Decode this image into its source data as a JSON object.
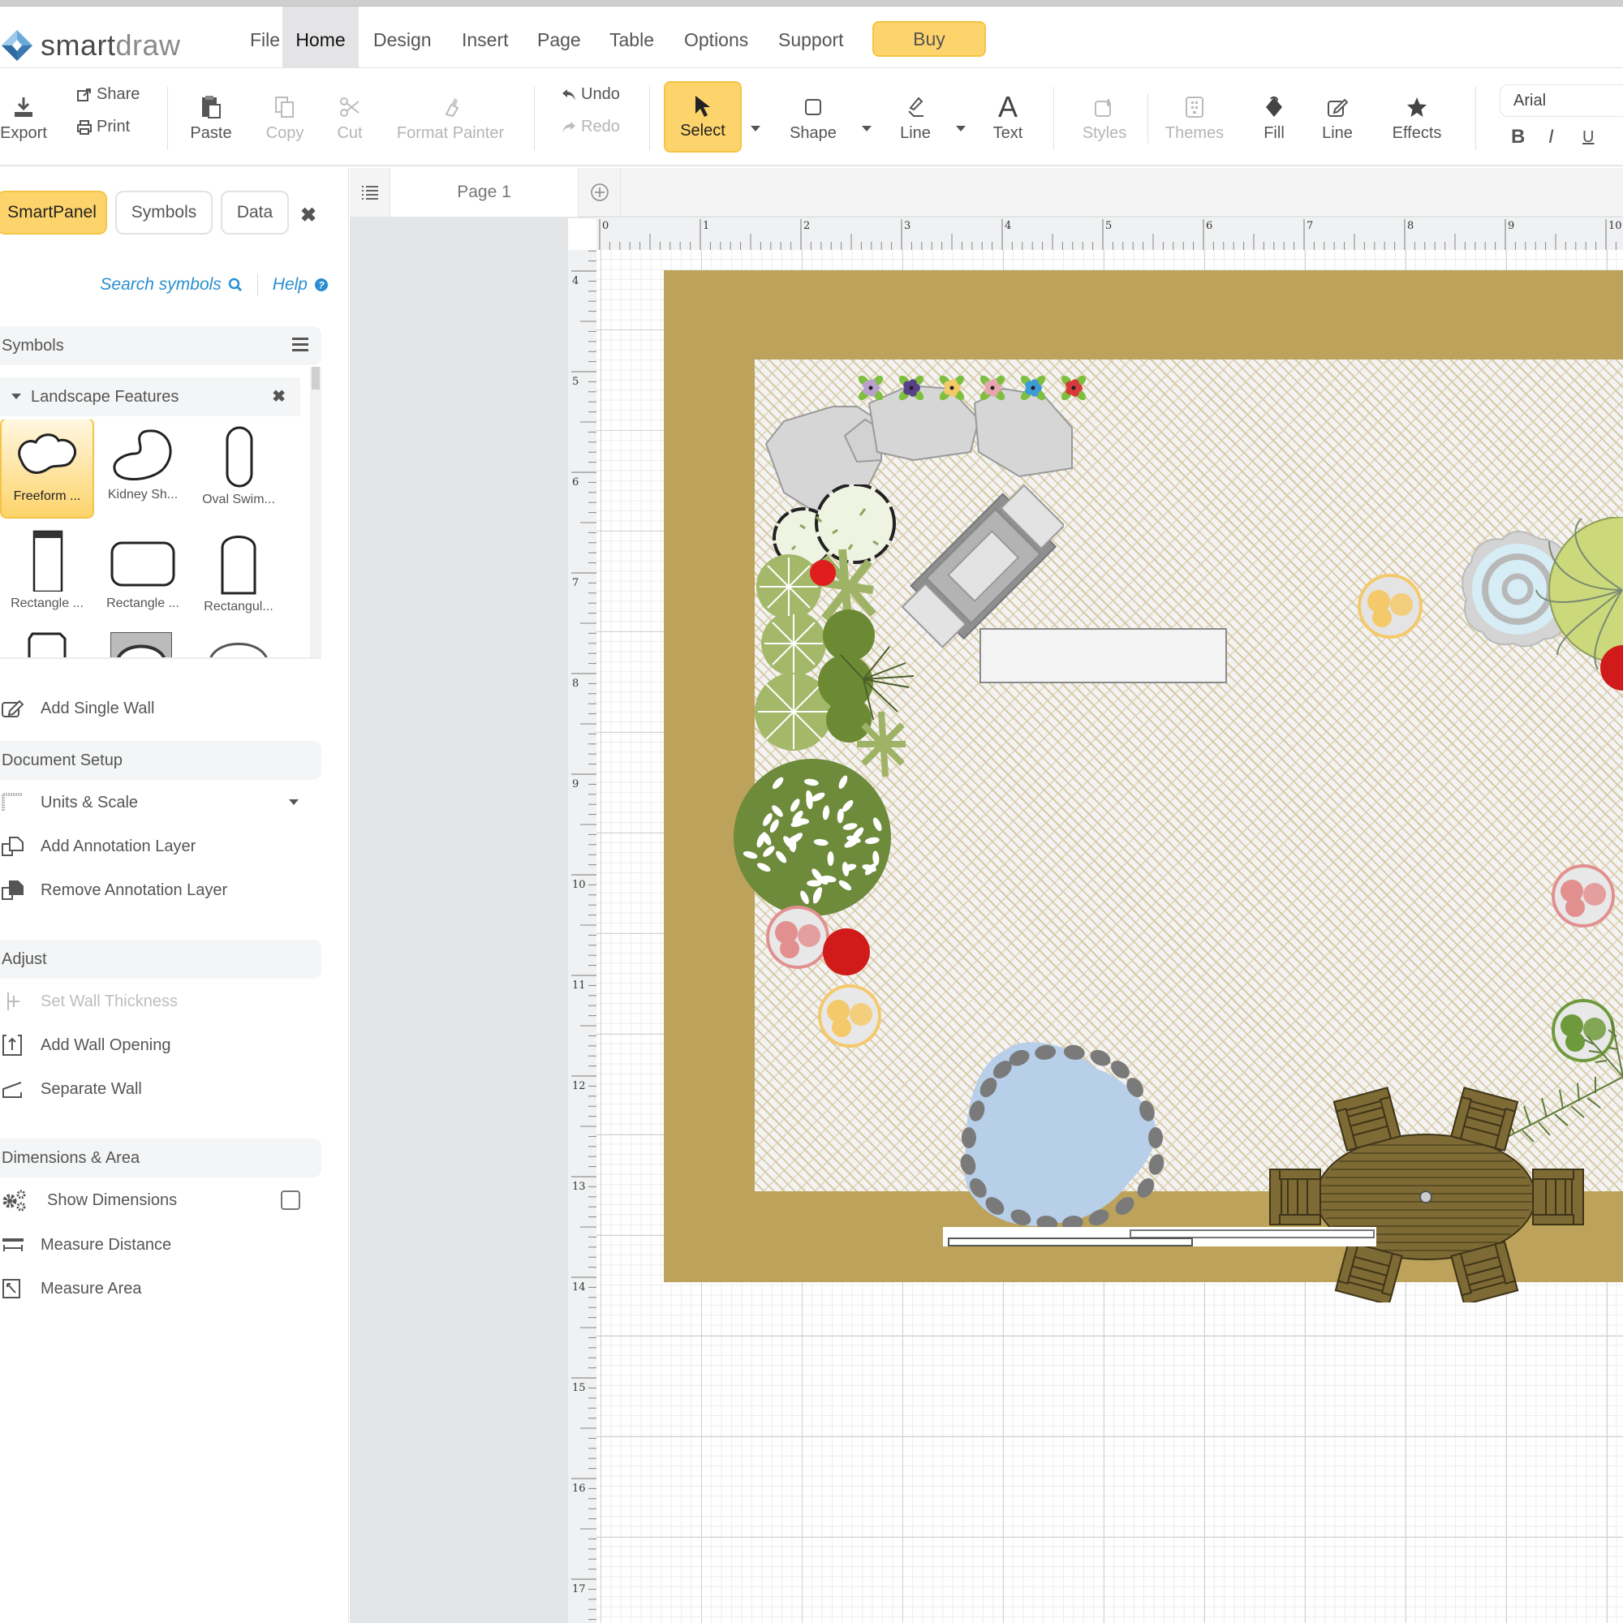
{
  "app": {
    "name_bold": "smart",
    "name_light": "draw"
  },
  "menu": {
    "tabs": [
      {
        "label": "File",
        "active": false
      },
      {
        "label": "Home",
        "active": true
      },
      {
        "label": "Design",
        "active": false
      },
      {
        "label": "Insert",
        "active": false
      },
      {
        "label": "Page",
        "active": false
      },
      {
        "label": "Table",
        "active": false
      },
      {
        "label": "Options",
        "active": false
      },
      {
        "label": "Support",
        "active": false
      }
    ],
    "buy_label": "Buy"
  },
  "toolbar": {
    "export": "Export",
    "share": "Share",
    "print": "Print",
    "paste": "Paste",
    "copy": "Copy",
    "cut": "Cut",
    "format_painter": "Format Painter",
    "undo": "Undo",
    "redo": "Redo",
    "select": "Select",
    "shape": "Shape",
    "line": "Line",
    "text": "Text",
    "styles": "Styles",
    "themes": "Themes",
    "fill": "Fill",
    "line_style": "Line",
    "effects": "Effects",
    "font": "Arial",
    "bold": "B",
    "italic": "I",
    "underline": "U"
  },
  "panel": {
    "tabs": [
      {
        "label": "SmartPanel",
        "active": true
      },
      {
        "label": "Symbols",
        "active": false
      },
      {
        "label": "Data",
        "active": false
      }
    ],
    "search_symbols": "Search symbols",
    "help": "Help",
    "symbols_header": "Symbols",
    "library": "Landscape Features",
    "symbols": [
      {
        "label": "Freeform ...",
        "selected": true,
        "shape": "freeform"
      },
      {
        "label": "Kidney Sh...",
        "selected": false,
        "shape": "kidney"
      },
      {
        "label": "Oval Swim...",
        "selected": false,
        "shape": "oval"
      },
      {
        "label": "Rectangle ...",
        "selected": false,
        "shape": "rect-tall"
      },
      {
        "label": "Rectangle ...",
        "selected": false,
        "shape": "rect-round"
      },
      {
        "label": "Rectangul...",
        "selected": false,
        "shape": "rect-arch"
      }
    ],
    "add_single_wall": "Add Single Wall",
    "document_setup": {
      "header": "Document Setup",
      "items": [
        "Units & Scale",
        "Add Annotation Layer",
        "Remove Annotation Layer"
      ]
    },
    "adjust": {
      "header": "Adjust",
      "items": [
        {
          "label": "Set Wall Thickness",
          "disabled": true
        },
        {
          "label": "Add Wall Opening",
          "disabled": false
        },
        {
          "label": "Separate Wall",
          "disabled": false
        }
      ]
    },
    "dimensions": {
      "header": "Dimensions & Area",
      "show_dimensions": "Show Dimensions",
      "show_dimensions_checked": false,
      "measure_distance": "Measure Distance",
      "measure_area": "Measure Area"
    }
  },
  "canvas": {
    "page_tab": "Page 1",
    "h_ruler": [
      "0",
      "1",
      "2",
      "3",
      "4",
      "5",
      "6",
      "7",
      "8",
      "9",
      "10"
    ],
    "v_ruler": [
      "4",
      "5",
      "6",
      "7",
      "8",
      "9",
      "10",
      "11",
      "12",
      "13",
      "14",
      "15",
      "16",
      "17"
    ],
    "colors": {
      "border": "#bca25a",
      "paver": "#f3f3f3",
      "accent": "#fdd46b",
      "link": "#2a8fd1"
    },
    "objects": [
      "boulders",
      "flowers",
      "fountain",
      "fire-pit",
      "bench",
      "tree-canopy",
      "shrubs",
      "pond",
      "dining-set",
      "palm",
      "gate"
    ]
  }
}
